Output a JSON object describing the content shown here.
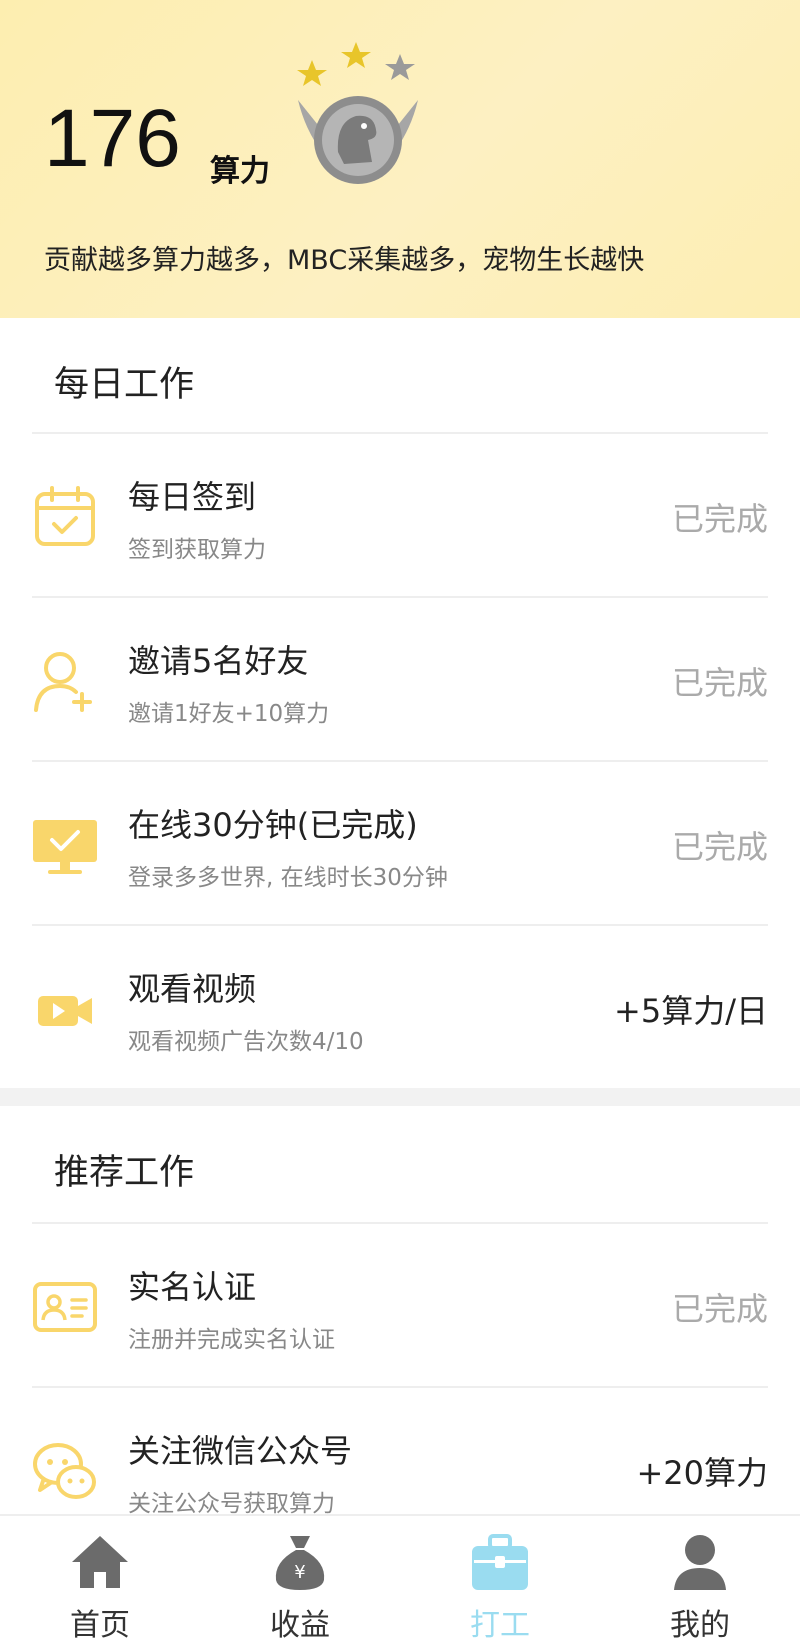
{
  "header": {
    "score": "176",
    "score_unit": "算力",
    "tagline": "贡献越多算力越多，MBC采集越多，宠物生长越快",
    "badge_icon": "dinosaur-medal-icon"
  },
  "daily": {
    "title": "每日工作",
    "items": [
      {
        "title": "每日签到",
        "subtitle": "签到获取算力",
        "status": "已完成",
        "icon": "calendar-check-icon"
      },
      {
        "title": "邀请5名好友",
        "subtitle": "邀请1好友+10算力",
        "status": "已完成",
        "icon": "add-user-icon"
      },
      {
        "title": "在线30分钟(已完成)",
        "subtitle": "登录多多世界, 在线时长30分钟",
        "status": "已完成",
        "icon": "monitor-icon"
      },
      {
        "title": "观看视频",
        "subtitle": "观看视频广告次数4/10",
        "status": "+5算力/日",
        "icon": "video-camera-icon"
      }
    ]
  },
  "recommended": {
    "title": "推荐工作",
    "items": [
      {
        "title": "实名认证",
        "subtitle": "注册并完成实名认证",
        "status": "已完成",
        "icon": "id-card-icon"
      },
      {
        "title": "关注微信公众号",
        "subtitle": "关注公众号获取算力",
        "status": "+20算力",
        "icon": "wechat-icon"
      }
    ]
  },
  "nav": {
    "items": [
      {
        "label": "首页",
        "icon": "home-icon"
      },
      {
        "label": "收益",
        "icon": "money-bag-icon"
      },
      {
        "label": "打工",
        "icon": "briefcase-icon"
      },
      {
        "label": "我的",
        "icon": "user-icon"
      }
    ],
    "active_index": 2
  },
  "colors": {
    "accent": "#f9d66b",
    "header_bg": "#fdeeb0",
    "nav_active": "#9adcf0",
    "muted": "#aaaaaa"
  }
}
